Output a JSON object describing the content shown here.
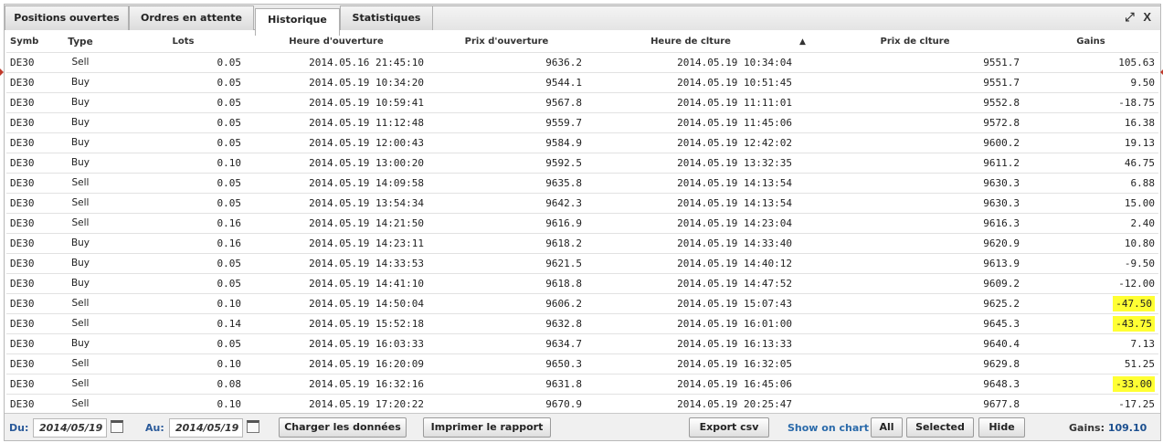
{
  "tabs": [
    {
      "label": "Positions ouvertes"
    },
    {
      "label": "Ordres en attente"
    },
    {
      "label": "Historique"
    },
    {
      "label": "Statistiques"
    }
  ],
  "window_icons": {
    "expand": "⤢",
    "close": "X"
  },
  "columns": {
    "symbol": "Symb",
    "type": "Type",
    "lots": "Lots",
    "open_time": "Heure d'ouverture",
    "open_price": "Prix d'ouverture",
    "close_time": "Heure de clture",
    "sort_indicator": "▲",
    "close_price": "Prix de clture",
    "gains": "Gains"
  },
  "rows": [
    {
      "symbol": "DE30",
      "type": "Sell",
      "lots": "0.05",
      "open_time": "2014.05.16 21:45:10",
      "open_price": "9636.2",
      "close_time": "2014.05.19 10:34:04",
      "close_price": "9551.7",
      "gains": "105.63",
      "highlight": false
    },
    {
      "symbol": "DE30",
      "type": "Buy",
      "lots": "0.05",
      "open_time": "2014.05.19 10:34:20",
      "open_price": "9544.1",
      "close_time": "2014.05.19 10:51:45",
      "close_price": "9551.7",
      "gains": "9.50",
      "highlight": false
    },
    {
      "symbol": "DE30",
      "type": "Buy",
      "lots": "0.05",
      "open_time": "2014.05.19 10:59:41",
      "open_price": "9567.8",
      "close_time": "2014.05.19 11:11:01",
      "close_price": "9552.8",
      "gains": "-18.75",
      "highlight": false
    },
    {
      "symbol": "DE30",
      "type": "Buy",
      "lots": "0.05",
      "open_time": "2014.05.19 11:12:48",
      "open_price": "9559.7",
      "close_time": "2014.05.19 11:45:06",
      "close_price": "9572.8",
      "gains": "16.38",
      "highlight": false
    },
    {
      "symbol": "DE30",
      "type": "Buy",
      "lots": "0.05",
      "open_time": "2014.05.19 12:00:43",
      "open_price": "9584.9",
      "close_time": "2014.05.19 12:42:02",
      "close_price": "9600.2",
      "gains": "19.13",
      "highlight": false
    },
    {
      "symbol": "DE30",
      "type": "Buy",
      "lots": "0.10",
      "open_time": "2014.05.19 13:00:20",
      "open_price": "9592.5",
      "close_time": "2014.05.19 13:32:35",
      "close_price": "9611.2",
      "gains": "46.75",
      "highlight": false
    },
    {
      "symbol": "DE30",
      "type": "Sell",
      "lots": "0.05",
      "open_time": "2014.05.19 14:09:58",
      "open_price": "9635.8",
      "close_time": "2014.05.19 14:13:54",
      "close_price": "9630.3",
      "gains": "6.88",
      "highlight": false
    },
    {
      "symbol": "DE30",
      "type": "Sell",
      "lots": "0.05",
      "open_time": "2014.05.19 13:54:34",
      "open_price": "9642.3",
      "close_time": "2014.05.19 14:13:54",
      "close_price": "9630.3",
      "gains": "15.00",
      "highlight": false
    },
    {
      "symbol": "DE30",
      "type": "Sell",
      "lots": "0.16",
      "open_time": "2014.05.19 14:21:50",
      "open_price": "9616.9",
      "close_time": "2014.05.19 14:23:04",
      "close_price": "9616.3",
      "gains": "2.40",
      "highlight": false
    },
    {
      "symbol": "DE30",
      "type": "Buy",
      "lots": "0.16",
      "open_time": "2014.05.19 14:23:11",
      "open_price": "9618.2",
      "close_time": "2014.05.19 14:33:40",
      "close_price": "9620.9",
      "gains": "10.80",
      "highlight": false
    },
    {
      "symbol": "DE30",
      "type": "Buy",
      "lots": "0.05",
      "open_time": "2014.05.19 14:33:53",
      "open_price": "9621.5",
      "close_time": "2014.05.19 14:40:12",
      "close_price": "9613.9",
      "gains": "-9.50",
      "highlight": false
    },
    {
      "symbol": "DE30",
      "type": "Buy",
      "lots": "0.05",
      "open_time": "2014.05.19 14:41:10",
      "open_price": "9618.8",
      "close_time": "2014.05.19 14:47:52",
      "close_price": "9609.2",
      "gains": "-12.00",
      "highlight": false
    },
    {
      "symbol": "DE30",
      "type": "Sell",
      "lots": "0.10",
      "open_time": "2014.05.19 14:50:04",
      "open_price": "9606.2",
      "close_time": "2014.05.19 15:07:43",
      "close_price": "9625.2",
      "gains": "-47.50",
      "highlight": true
    },
    {
      "symbol": "DE30",
      "type": "Sell",
      "lots": "0.14",
      "open_time": "2014.05.19 15:52:18",
      "open_price": "9632.8",
      "close_time": "2014.05.19 16:01:00",
      "close_price": "9645.3",
      "gains": "-43.75",
      "highlight": true
    },
    {
      "symbol": "DE30",
      "type": "Buy",
      "lots": "0.05",
      "open_time": "2014.05.19 16:03:33",
      "open_price": "9634.7",
      "close_time": "2014.05.19 16:13:33",
      "close_price": "9640.4",
      "gains": "7.13",
      "highlight": false
    },
    {
      "symbol": "DE30",
      "type": "Sell",
      "lots": "0.10",
      "open_time": "2014.05.19 16:20:09",
      "open_price": "9650.3",
      "close_time": "2014.05.19 16:32:05",
      "close_price": "9629.8",
      "gains": "51.25",
      "highlight": false
    },
    {
      "symbol": "DE30",
      "type": "Sell",
      "lots": "0.08",
      "open_time": "2014.05.19 16:32:16",
      "open_price": "9631.8",
      "close_time": "2014.05.19 16:45:06",
      "close_price": "9648.3",
      "gains": "-33.00",
      "highlight": true
    },
    {
      "symbol": "DE30",
      "type": "Sell",
      "lots": "0.10",
      "open_time": "2014.05.19 17:20:22",
      "open_price": "9670.9",
      "close_time": "2014.05.19 20:25:47",
      "close_price": "9677.8",
      "gains": "-17.25",
      "highlight": false
    }
  ],
  "footer": {
    "from_label": "Du:",
    "from_date": "2014/05/19",
    "to_label": "Au:",
    "to_date": "2014/05/19",
    "load_button": "Charger les données",
    "print_button": "Imprimer le rapport",
    "export_button": "Export csv",
    "show_on_chart": "Show on chart",
    "all_button": "All",
    "selected_button": "Selected",
    "hide_button": "Hide",
    "gains_label": "Gains:",
    "gains_total": "109.10"
  },
  "colors": {
    "highlight": "#ffff33",
    "accent": "#2a6aaa"
  }
}
